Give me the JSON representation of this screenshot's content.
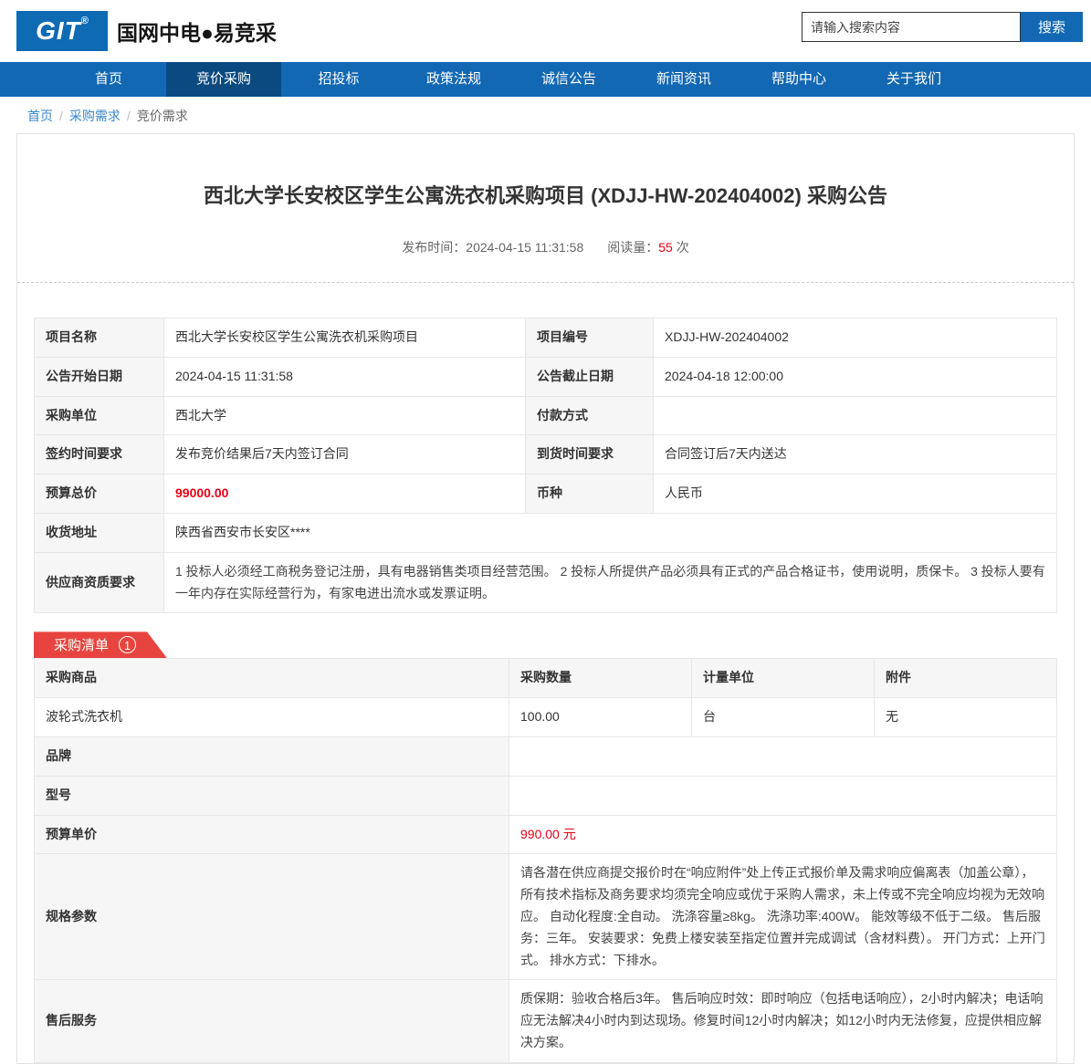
{
  "theme": {
    "primary_blue": "#1268b3",
    "primary_blue_dark": "#0b4a80",
    "badge_red": "#e8443f",
    "price_red": "#e60012"
  },
  "header": {
    "logo_text": "GIT",
    "logo_reg": "®",
    "site_name": "国网中电●易竞采",
    "search_placeholder": "请输入搜索内容",
    "search_button": "搜索"
  },
  "nav": {
    "items": [
      {
        "label": "首页",
        "active": false
      },
      {
        "label": "竞价采购",
        "active": true
      },
      {
        "label": "招投标",
        "active": false
      },
      {
        "label": "政策法规",
        "active": false
      },
      {
        "label": "诚信公告",
        "active": false
      },
      {
        "label": "新闻资讯",
        "active": false
      },
      {
        "label": "帮助中心",
        "active": false
      },
      {
        "label": "关于我们",
        "active": false
      }
    ]
  },
  "breadcrumb": {
    "separator": "/",
    "items": [
      "首页",
      "采购需求",
      "竞价需求"
    ]
  },
  "announcement": {
    "title": "西北大学长安校区学生公寓洗衣机采购项目 (XDJJ-HW-202404002) 采购公告",
    "publish_label": "发布时间：",
    "publish_time": "2024-04-15 11:31:58",
    "views_label": "阅读量：",
    "views_count": "55",
    "views_unit": "次"
  },
  "info_table": {
    "rows": [
      {
        "label1": "项目名称",
        "value1": "西北大学长安校区学生公寓洗衣机采购项目",
        "label2": "项目编号",
        "value2": "XDJJ-HW-202404002"
      },
      {
        "label1": "公告开始日期",
        "value1": "2024-04-15 11:31:58",
        "label2": "公告截止日期",
        "value2": "2024-04-18 12:00:00"
      },
      {
        "label1": "采购单位",
        "value1": "西北大学",
        "label2": "付款方式",
        "value2": ""
      },
      {
        "label1": "签约时间要求",
        "value1": "发布竞价结果后7天内签订合同",
        "label2": "到货时间要求",
        "value2": "合同签订后7天内送达"
      },
      {
        "label1": "预算总价",
        "value1": "99000.00",
        "label2": "币种",
        "value2": "人民币"
      }
    ],
    "address_row": {
      "label": "收货地址",
      "value": "陕西省西安市长安区****"
    },
    "qualification_row": {
      "label": "供应商资质要求",
      "value": "1 投标人必须经工商税务登记注册，具有电器销售类项目经营范围。 2 投标人所提供产品必须具有正式的产品合格证书，使用说明，质保卡。 3 投标人要有一年内存在实际经营行为，有家电进出流水或发票证明。"
    }
  },
  "purchase_list": {
    "badge_label": "采购清单",
    "badge_count": "1",
    "columns": [
      "采购商品",
      "采购数量",
      "计量单位",
      "附件"
    ],
    "items": [
      {
        "product": "波轮式洗衣机",
        "quantity": "100.00",
        "unit": "台",
        "attachment": "无"
      }
    ],
    "details": [
      {
        "label": "品牌",
        "value": ""
      },
      {
        "label": "型号",
        "value": ""
      },
      {
        "label": "预算单价",
        "value": "990.00 元"
      },
      {
        "label": "规格参数",
        "value": "请各潜在供应商提交报价时在“响应附件”处上传正式报价单及需求响应偏离表（加盖公章），所有技术指标及商务要求均须完全响应或优于采购人需求，未上传或不完全响应均视为无效响应。 自动化程度:全自动。 洗涤容量≥8kg。 洗涤功率:400W。 能效等级不低于二级。 售后服务：三年。 安装要求：免费上楼安装至指定位置并完成调试（含材料费）。 开门方式：上开门式。 排水方式：下排水。"
      },
      {
        "label": "售后服务",
        "value": "质保期：验收合格后3年。 售后响应时效：即时响应（包括电话响应），2小时内解决；电话响应无法解决4小时内到达现场。修复时间12小时内解决；如12小时内无法修复，应提供相应解决方案。"
      }
    ]
  }
}
